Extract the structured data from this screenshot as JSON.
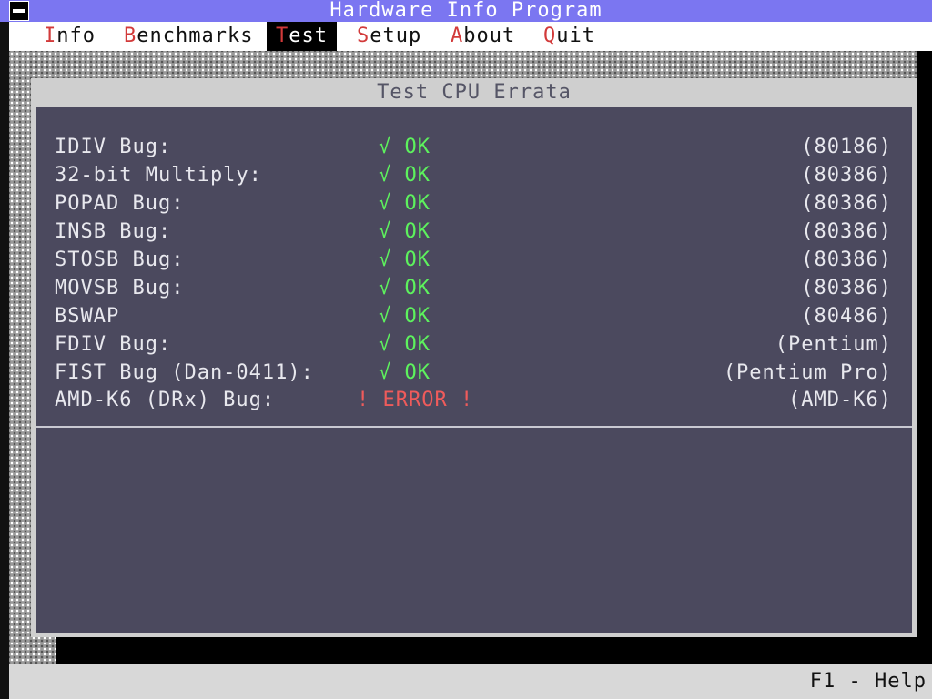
{
  "app": {
    "title": "Hardware Info Program"
  },
  "menu": {
    "items": [
      {
        "hot": "I",
        "rest": "nfo"
      },
      {
        "hot": "B",
        "rest": "enchmarks"
      },
      {
        "hot": "T",
        "rest": "est"
      },
      {
        "hot": "S",
        "rest": "etup"
      },
      {
        "hot": "A",
        "rest": "bout"
      },
      {
        "hot": "Q",
        "rest": "uit"
      }
    ],
    "active_index": 2
  },
  "window": {
    "title": "Test CPU Errata"
  },
  "tests": [
    {
      "label": "IDIV Bug:",
      "status": "√ OK",
      "cpu": "(80186)",
      "result": "ok"
    },
    {
      "label": "32-bit Multiply:",
      "status": "√ OK",
      "cpu": "(80386)",
      "result": "ok"
    },
    {
      "label": "POPAD Bug:",
      "status": "√ OK",
      "cpu": "(80386)",
      "result": "ok"
    },
    {
      "label": "INSB Bug:",
      "status": "√ OK",
      "cpu": "(80386)",
      "result": "ok"
    },
    {
      "label": "STOSB Bug:",
      "status": "√ OK",
      "cpu": "(80386)",
      "result": "ok"
    },
    {
      "label": "MOVSB Bug:",
      "status": "√ OK",
      "cpu": "(80386)",
      "result": "ok"
    },
    {
      "label": "BSWAP",
      "status": "√ OK",
      "cpu": "(80486)",
      "result": "ok"
    },
    {
      "label": "FDIV Bug:",
      "status": "√ OK",
      "cpu": "(Pentium)",
      "result": "ok"
    },
    {
      "label": "FIST Bug (Dan-0411):",
      "status": "√ OK",
      "cpu": "(Pentium Pro)",
      "result": "ok"
    },
    {
      "label": "AMD-K6 (DRx) Bug:",
      "status": "! ERROR !",
      "cpu": "(AMD-K6)",
      "result": "err"
    }
  ],
  "statusbar": {
    "help": "F1 - Help"
  },
  "colors": {
    "title_bar": "#7b76f1",
    "panel": "#4b495e",
    "ok": "#5df25d",
    "error": "#ef5b5b",
    "hotkey": "#d23a3a"
  }
}
